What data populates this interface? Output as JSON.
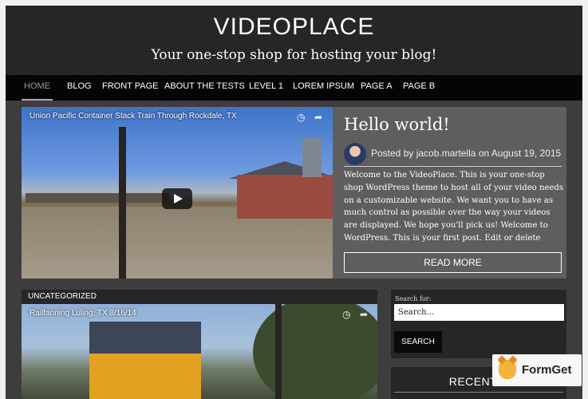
{
  "site": {
    "title": "VIDEOPLACE",
    "tagline": "Your one-stop shop for hosting your blog!"
  },
  "nav": {
    "items": [
      "HOME",
      "BLOG",
      "FRONT PAGE",
      "ABOUT THE TESTS",
      "LEVEL 1",
      "LOREM IPSUM",
      "PAGE A",
      "PAGE B"
    ],
    "active": "HOME"
  },
  "featured_video": {
    "title": "Union Pacific Container Stack Train Through Rockdale, TX"
  },
  "post": {
    "title": "Hello world!",
    "meta_prefix": "Posted by",
    "author": "jacob.martella",
    "meta_mid": "on",
    "date": "August 19, 2015",
    "excerpt": "Welcome to the VideoPlace. This is your one-stop shop WordPress theme to host all of  your video needs on a customizable website. We want you to have as much control as possible over the way your videos are displayed. We hope you'll pick us! Welcome to WordPress. This is your first post. Edit or delete",
    "read_more": "READ MORE"
  },
  "category": {
    "label": "UNCATEGORIZED"
  },
  "second_video": {
    "title": "Railfanning Luling, TX 8/16/14"
  },
  "search_widget": {
    "label": "Search for:",
    "placeholder": "Search...",
    "button": "SEARCH"
  },
  "recent_widget": {
    "title": "RECENT P"
  },
  "badge": {
    "text": "FormGet"
  },
  "icons": {
    "watch_later": "clock-icon",
    "share": "share-icon",
    "play": "play-icon"
  },
  "colors": {
    "header_bg": "#262626",
    "nav_bg": "#050505",
    "page_bg": "#3d3d3d",
    "post_panel_bg": "#5e5e5e",
    "badge_orange": "#f2b33d"
  }
}
